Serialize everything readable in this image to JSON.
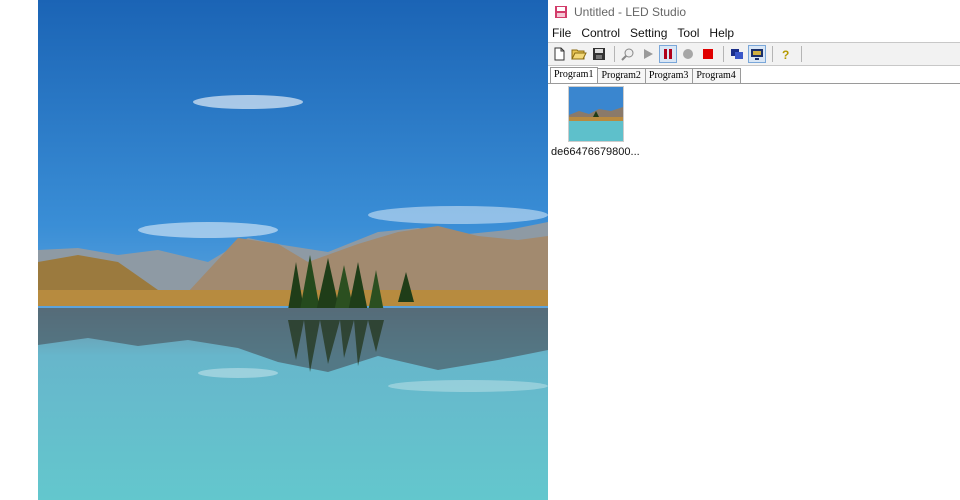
{
  "window": {
    "title": "Untitled - LED Studio"
  },
  "menu": [
    "File",
    "Control",
    "Setting",
    "Tool",
    "Help"
  ],
  "toolbar": {
    "buttons": [
      "new-file",
      "open-folder",
      "save",
      "zoom",
      "play",
      "pause",
      "record",
      "stop",
      "window-overlap",
      "screen-toggle",
      "help"
    ]
  },
  "tabs": [
    "Program1",
    "Program2",
    "Program3",
    "Program4"
  ],
  "active_tab": "Program1",
  "thumbnails": [
    {
      "label": "de66476679800..."
    }
  ],
  "colors": {
    "accent": "#cc0000",
    "sky": "#2f7cc6",
    "lake": "#5fc2cc"
  }
}
